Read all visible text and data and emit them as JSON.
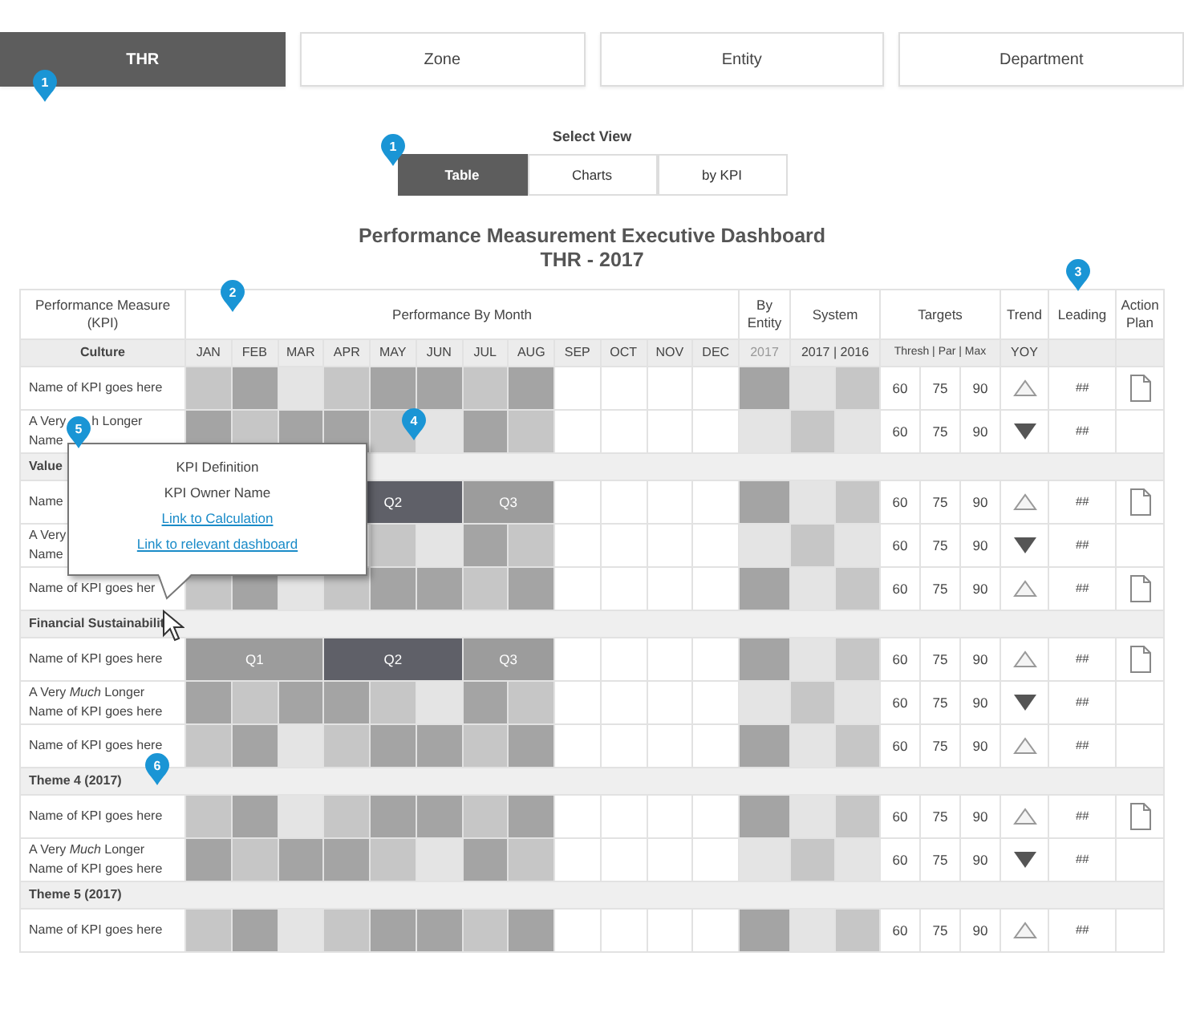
{
  "top_tabs": [
    {
      "label": "THR",
      "selected": true
    },
    {
      "label": "Zone",
      "selected": false
    },
    {
      "label": "Entity",
      "selected": false
    },
    {
      "label": "Department",
      "selected": false
    }
  ],
  "view_selector": {
    "label": "Select View",
    "options": [
      {
        "label": "Table",
        "selected": true
      },
      {
        "label": "Charts",
        "selected": false
      },
      {
        "label": "by KPI",
        "selected": false
      }
    ]
  },
  "title": "Performance Measurement Executive Dashboard",
  "subtitle": "THR - 2017",
  "table": {
    "headers": {
      "kpi": "Performance Measure (KPI)",
      "by_month": "Performance By Month",
      "by_entity": "By Entity",
      "system": "System",
      "targets": "Targets",
      "trend": "Trend",
      "leading": "Leading",
      "action_plan": "Action Plan"
    },
    "first_group": "Culture",
    "months": [
      "JAN",
      "FEB",
      "MAR",
      "APR",
      "MAY",
      "JUN",
      "JUL",
      "AUG",
      "SEP",
      "OCT",
      "NOV",
      "DEC"
    ],
    "entity_year": "2017",
    "system_years": "2017 | 2016",
    "targets_sub": "Thresh | Par | Max",
    "trend_sub": "YOY",
    "rows": [
      {
        "kind": "kpi",
        "name_lines": [
          [
            "Name of KPI goes here"
          ]
        ],
        "cells": [
          {
            "color": "#c6c6c6"
          },
          {
            "color": "#a4a4a4"
          },
          {
            "color": "#e4e4e4"
          },
          {
            "color": "#c6c6c6"
          },
          {
            "color": "#a4a4a4"
          },
          {
            "color": "#a4a4a4"
          },
          {
            "color": "#c6c6c6"
          },
          {
            "color": "#a4a4a4"
          }
        ],
        "scores": [
          {
            "color": "#a4a4a4"
          },
          {
            "color": "#e4e4e4"
          },
          {
            "color": "#c6c6c6"
          }
        ],
        "targets": [
          "60",
          "75",
          "90"
        ],
        "trend_up": true,
        "leading": "##",
        "action_plan": true
      },
      {
        "kind": "kpi",
        "name_lines": [
          [
            "A Very",
            "h Longer"
          ],
          [
            "Name"
          ]
        ],
        "cells": [
          {
            "color": "#a4a4a4"
          },
          {
            "color": "#c6c6c6"
          },
          {
            "color": "#a4a4a4"
          },
          {
            "color": "#a4a4a4"
          },
          {
            "color": "#c6c6c6"
          },
          {
            "color": "#e4e4e4"
          },
          {
            "color": "#a4a4a4"
          },
          {
            "color": "#c6c6c6"
          }
        ],
        "scores": [
          {
            "color": "#e4e4e4"
          },
          {
            "color": "#c6c6c6"
          },
          {
            "color": "#e4e4e4"
          }
        ],
        "targets": [
          "60",
          "75",
          "90"
        ],
        "trend_up": false,
        "leading": "##",
        "action_plan": false
      },
      {
        "kind": "group",
        "label": "Value"
      },
      {
        "kind": "kpi",
        "name_lines": [
          [
            "Name"
          ]
        ],
        "cells": [
          null,
          {
            "label": "Q2",
            "color": "#5f6068"
          },
          {
            "label": "Q3",
            "color": "#9c9c9c"
          }
        ],
        "scores": [
          {
            "color": "#a4a4a4"
          },
          {
            "color": "#e4e4e4"
          },
          {
            "color": "#c6c6c6"
          }
        ],
        "targets": [
          "60",
          "75",
          "90"
        ],
        "trend_up": true,
        "leading": "##",
        "action_plan": true
      },
      {
        "kind": "kpi",
        "name_lines": [
          [
            "A Very"
          ],
          [
            "Name"
          ]
        ],
        "cells": [
          null,
          null,
          null,
          null,
          {
            "color": "#c6c6c6"
          },
          {
            "color": "#e4e4e4"
          },
          {
            "color": "#a4a4a4"
          },
          {
            "color": "#c6c6c6"
          }
        ],
        "scores": [
          {
            "color": "#e4e4e4"
          },
          {
            "color": "#c6c6c6"
          },
          {
            "color": "#e4e4e4"
          }
        ],
        "targets": [
          "60",
          "75",
          "90"
        ],
        "trend_up": false,
        "leading": "##",
        "action_plan": false
      },
      {
        "kind": "kpi",
        "name_lines": [
          [
            "Name of KPI goes her"
          ]
        ],
        "cells": [
          {
            "color": "#c6c6c6"
          },
          {
            "color": "#a4a4a4"
          },
          {
            "color": "#e4e4e4"
          },
          {
            "color": "#c6c6c6"
          },
          {
            "color": "#a4a4a4"
          },
          {
            "color": "#a4a4a4"
          },
          {
            "color": "#c6c6c6"
          },
          {
            "color": "#a4a4a4"
          }
        ],
        "scores": [
          {
            "color": "#a4a4a4"
          },
          {
            "color": "#e4e4e4"
          },
          {
            "color": "#c6c6c6"
          }
        ],
        "targets": [
          "60",
          "75",
          "90"
        ],
        "trend_up": true,
        "leading": "##",
        "action_plan": true
      },
      {
        "kind": "group",
        "label": "Financial Sustainabilit"
      },
      {
        "kind": "kpi",
        "name_lines": [
          [
            "Name of KPI goes here"
          ]
        ],
        "cells": [
          {
            "label": "Q1",
            "color": "#9c9c9c"
          },
          {
            "label": "Q2",
            "color": "#5f6068"
          },
          {
            "label": "Q3",
            "color": "#9c9c9c"
          }
        ],
        "scores": [
          {
            "color": "#a4a4a4"
          },
          {
            "color": "#e4e4e4"
          },
          {
            "color": "#c6c6c6"
          }
        ],
        "targets": [
          "60",
          "75",
          "90"
        ],
        "trend_up": true,
        "leading": "##",
        "action_plan": true
      },
      {
        "kind": "kpi",
        "name_lines": [
          [
            "A Very *Much* Longer"
          ],
          [
            "Name of KPI goes here"
          ]
        ],
        "cells": [
          {
            "color": "#a4a4a4"
          },
          {
            "color": "#c6c6c6"
          },
          {
            "color": "#a4a4a4"
          },
          {
            "color": "#a4a4a4"
          },
          {
            "color": "#c6c6c6"
          },
          {
            "color": "#e4e4e4"
          },
          {
            "color": "#a4a4a4"
          },
          {
            "color": "#c6c6c6"
          }
        ],
        "scores": [
          {
            "color": "#e4e4e4"
          },
          {
            "color": "#c6c6c6"
          },
          {
            "color": "#e4e4e4"
          }
        ],
        "targets": [
          "60",
          "75",
          "90"
        ],
        "trend_up": false,
        "leading": "##",
        "action_plan": false
      },
      {
        "kind": "kpi",
        "name_lines": [
          [
            "Name of KPI goes here"
          ]
        ],
        "cells": [
          {
            "color": "#c6c6c6"
          },
          {
            "color": "#a4a4a4"
          },
          {
            "color": "#e4e4e4"
          },
          {
            "color": "#c6c6c6"
          },
          {
            "color": "#a4a4a4"
          },
          {
            "color": "#a4a4a4"
          },
          {
            "color": "#c6c6c6"
          },
          {
            "color": "#a4a4a4"
          }
        ],
        "scores": [
          {
            "color": "#a4a4a4"
          },
          {
            "color": "#e4e4e4"
          },
          {
            "color": "#c6c6c6"
          }
        ],
        "targets": [
          "60",
          "75",
          "90"
        ],
        "trend_up": true,
        "leading": "##",
        "action_plan": false
      },
      {
        "kind": "group",
        "label": "Theme 4 (2017)"
      },
      {
        "kind": "kpi",
        "name_lines": [
          [
            "Name of KPI goes here"
          ]
        ],
        "cells": [
          {
            "color": "#c6c6c6"
          },
          {
            "color": "#a4a4a4"
          },
          {
            "color": "#e4e4e4"
          },
          {
            "color": "#c6c6c6"
          },
          {
            "color": "#a4a4a4"
          },
          {
            "color": "#a4a4a4"
          },
          {
            "color": "#c6c6c6"
          },
          {
            "color": "#a4a4a4"
          }
        ],
        "scores": [
          {
            "color": "#a4a4a4"
          },
          {
            "color": "#e4e4e4"
          },
          {
            "color": "#c6c6c6"
          }
        ],
        "targets": [
          "60",
          "75",
          "90"
        ],
        "trend_up": true,
        "leading": "##",
        "action_plan": true
      },
      {
        "kind": "kpi",
        "name_lines": [
          [
            "A Very *Much* Longer"
          ],
          [
            "Name of KPI goes here"
          ]
        ],
        "cells": [
          {
            "color": "#a4a4a4"
          },
          {
            "color": "#c6c6c6"
          },
          {
            "color": "#a4a4a4"
          },
          {
            "color": "#a4a4a4"
          },
          {
            "color": "#c6c6c6"
          },
          {
            "color": "#e4e4e4"
          },
          {
            "color": "#a4a4a4"
          },
          {
            "color": "#c6c6c6"
          }
        ],
        "scores": [
          {
            "color": "#e4e4e4"
          },
          {
            "color": "#c6c6c6"
          },
          {
            "color": "#e4e4e4"
          }
        ],
        "targets": [
          "60",
          "75",
          "90"
        ],
        "trend_up": false,
        "leading": "##",
        "action_plan": false
      },
      {
        "kind": "group",
        "label": "Theme 5 (2017)"
      },
      {
        "kind": "kpi",
        "name_lines": [
          [
            "Name of KPI goes here"
          ]
        ],
        "cells": [
          {
            "color": "#c6c6c6"
          },
          {
            "color": "#a4a4a4"
          },
          {
            "color": "#e4e4e4"
          },
          {
            "color": "#c6c6c6"
          },
          {
            "color": "#a4a4a4"
          },
          {
            "color": "#a4a4a4"
          },
          {
            "color": "#c6c6c6"
          },
          {
            "color": "#a4a4a4"
          }
        ],
        "scores": [
          {
            "color": "#a4a4a4"
          },
          {
            "color": "#e4e4e4"
          },
          {
            "color": "#c6c6c6"
          }
        ],
        "targets": [
          "60",
          "75",
          "90"
        ],
        "trend_up": true,
        "leading": "##",
        "action_plan": false
      }
    ]
  },
  "tooltip": {
    "lines": [
      "KPI Definition",
      "KPI Owner Name"
    ],
    "links": [
      "Link to Calculation",
      "Link to relevant dashboard"
    ]
  },
  "callouts": [
    "1",
    "1",
    "2",
    "3",
    "4",
    "5",
    "6"
  ]
}
